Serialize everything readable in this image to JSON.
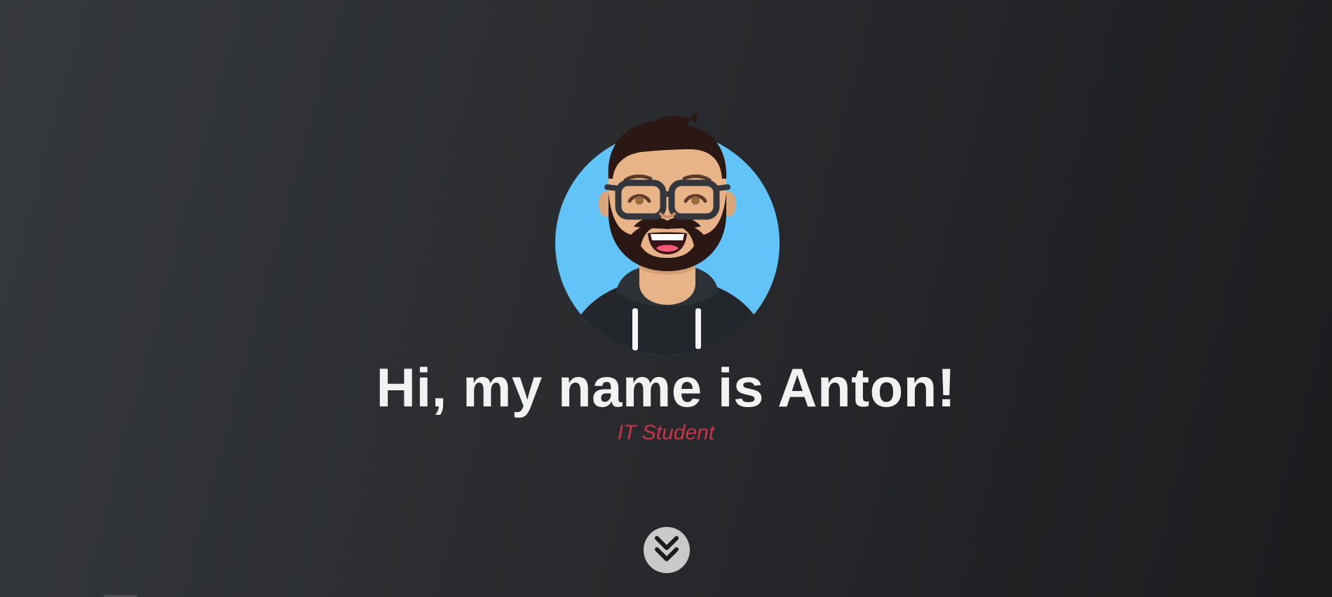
{
  "hero": {
    "headline": "Hi, my name is Anton!",
    "subtitle": "IT Student",
    "avatar_icon": "bearded-man-glasses-avatar",
    "scroll_icon": "double-chevron-down-icon"
  },
  "colors": {
    "background": "#2a2c2f",
    "headline": "#f2f2f2",
    "subtitle": "#c7344a",
    "avatar_circle": "#62c3f8",
    "scroll_button": "#c9c9c9"
  }
}
